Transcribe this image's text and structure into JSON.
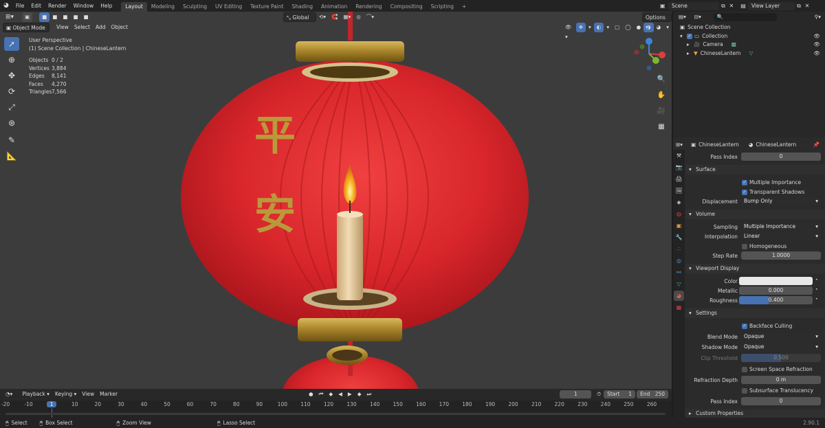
{
  "topbar": {
    "menus": [
      "File",
      "Edit",
      "Render",
      "Window",
      "Help"
    ],
    "workspaces": [
      "Layout",
      "Modeling",
      "Sculpting",
      "UV Editing",
      "Texture Paint",
      "Shading",
      "Animation",
      "Rendering",
      "Compositing",
      "Scripting"
    ],
    "add_tab": "+",
    "scene": "Scene",
    "view_layer": "View Layer"
  },
  "viewport_header": {
    "mode": "Object Mode",
    "menus": [
      "View",
      "Select",
      "Add",
      "Object"
    ],
    "orientation": "Global",
    "options": "Options"
  },
  "stats": {
    "perspective": "User Perspective",
    "collection": "(1) Scene Collection | ChineseLantern",
    "rows": [
      {
        "label": "Objects",
        "value": "0 / 2"
      },
      {
        "label": "Vertices",
        "value": "3,884"
      },
      {
        "label": "Edges",
        "value": "8,141"
      },
      {
        "label": "Faces",
        "value": "4,270"
      },
      {
        "label": "Triangles",
        "value": "7,566"
      }
    ]
  },
  "scene_text": {
    "char1": "平",
    "char2": "安"
  },
  "outliner": {
    "root": "Scene Collection",
    "collection": "Collection",
    "items": [
      "Camera",
      "ChineseLantern"
    ]
  },
  "properties": {
    "object": "ChineseLantern",
    "material": "ChineseLantern",
    "pass_index": {
      "label": "Pass Index",
      "value": "0"
    },
    "surface": {
      "title": "Surface",
      "multiple_importance": "Multiple Importance",
      "transparent_shadows": "Transparent Shadows",
      "displacement_label": "Displacement",
      "displacement_value": "Bump Only"
    },
    "volume": {
      "title": "Volume",
      "sampling_label": "Sampling",
      "sampling_value": "Multiple Importance",
      "interpolation_label": "Interpolation",
      "interpolation_value": "Linear",
      "homogeneous": "Homogeneous",
      "step_rate_label": "Step Rate",
      "step_rate_value": "1.0000"
    },
    "viewport_display": {
      "title": "Viewport Display",
      "color_label": "Color",
      "color_value": "#e8e8e8",
      "metallic_label": "Metallic",
      "metallic_value": "0.000",
      "roughness_label": "Roughness",
      "roughness_value": "0.400",
      "roughness_fraction": 0.4
    },
    "settings": {
      "title": "Settings",
      "backface_culling": "Backface Culling",
      "blend_mode_label": "Blend Mode",
      "blend_mode_value": "Opaque",
      "shadow_mode_label": "Shadow Mode",
      "shadow_mode_value": "Opaque",
      "clip_threshold_label": "Clip Threshold",
      "clip_threshold_value": "0.500",
      "clip_threshold_fraction": 0.5,
      "screen_space_refraction": "Screen Space Refraction",
      "refraction_depth_label": "Refraction Depth",
      "refraction_depth_value": "0 m",
      "subsurface_translucency": "Subsurface Translucency",
      "pass_index_label": "Pass Index",
      "pass_index_value": "0"
    },
    "custom_properties": "Custom Properties"
  },
  "timeline": {
    "menus": [
      "Playback",
      "Keying",
      "View",
      "Marker"
    ],
    "current_frame": "1",
    "start_label": "Start",
    "start_value": "1",
    "end_label": "End",
    "end_value": "250",
    "ticks": [
      "-20",
      "-10",
      "1",
      "10",
      "20",
      "30",
      "40",
      "50",
      "60",
      "70",
      "80",
      "90",
      "100",
      "110",
      "120",
      "130",
      "140",
      "150",
      "160",
      "170",
      "180",
      "190",
      "200",
      "210",
      "220",
      "230",
      "240",
      "250",
      "260"
    ]
  },
  "statusbar": {
    "select": "Select",
    "box_select": "Box Select",
    "zoom_view": "Zoom View",
    "lasso_select": "Lasso Select",
    "version": "2.90.1"
  },
  "colors": {
    "accent": "#4772b3",
    "lantern_red": "#d8262b",
    "gold": "#b89430",
    "frame_cursor": "#4772b3"
  }
}
